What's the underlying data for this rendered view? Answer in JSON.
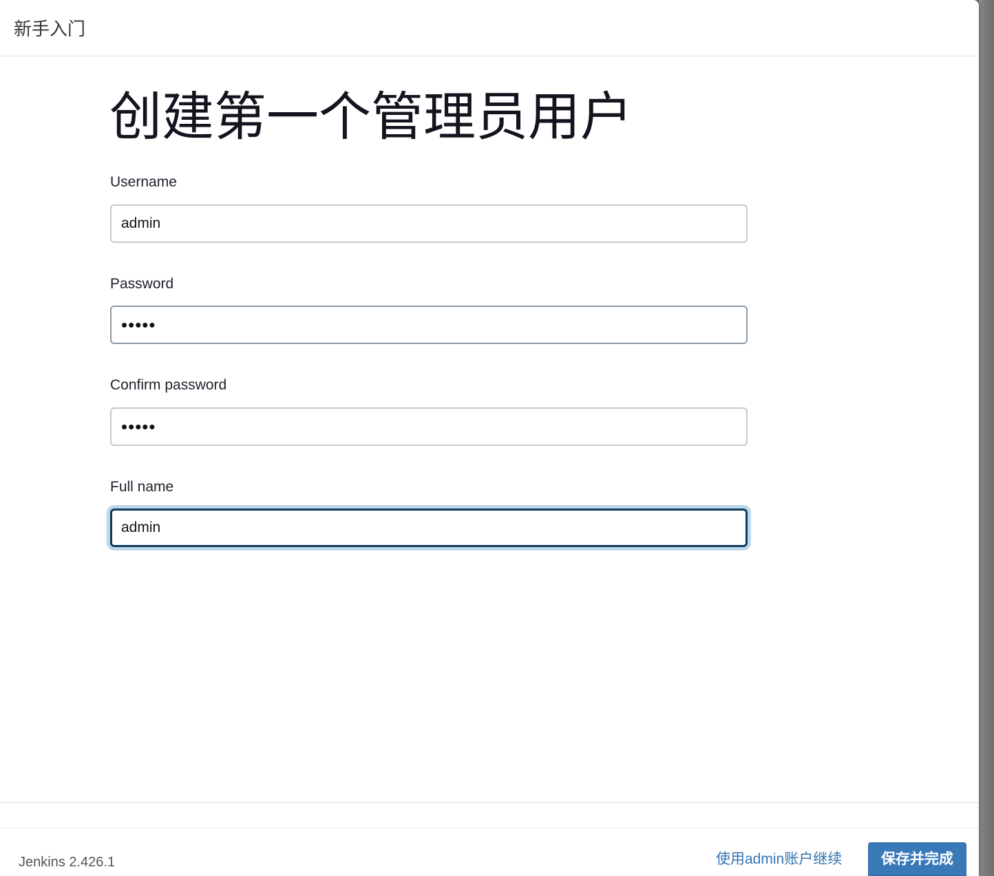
{
  "header": {
    "title": "新手入门"
  },
  "page": {
    "title": "创建第一个管理员用户"
  },
  "form": {
    "username": {
      "label": "Username",
      "value": "admin"
    },
    "password": {
      "label": "Password",
      "value": "admin"
    },
    "confirm_password": {
      "label": "Confirm password",
      "value": "admin"
    },
    "full_name": {
      "label": "Full name",
      "value": "admin"
    }
  },
  "footer": {
    "version": "Jenkins 2.426.1",
    "continue_link": "使用admin账户继续",
    "save_button": "保存并完成"
  },
  "colors": {
    "link": "#3374b3",
    "primary_button": "#3a79b8",
    "focus_border": "#0e3a5c",
    "focus_ring": "#bcd7ea"
  }
}
